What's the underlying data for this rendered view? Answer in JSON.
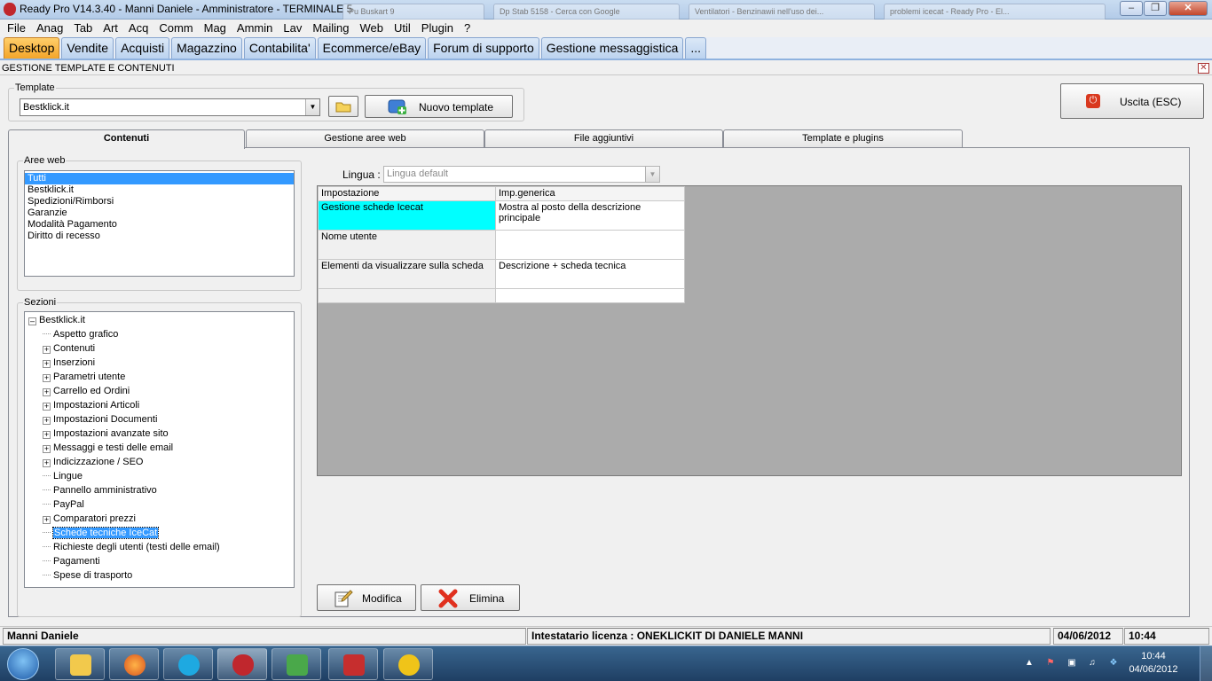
{
  "window": {
    "title": "Ready Pro V14.3.40 - Manni Daniele - Amministratore - TERMINALE 5",
    "background_tabs": [
      "Pu Buskart 9",
      "Dp Stab 5158 - Cerca con Google",
      "Ventilatori - Benzinawii nell'uso dei...",
      "problemi icecat - Ready Pro - El..."
    ]
  },
  "menu": [
    "File",
    "Anag",
    "Tab",
    "Art",
    "Acq",
    "Comm",
    "Mag",
    "Ammin",
    "Lav",
    "Mailing",
    "Web",
    "Util",
    "Plugin",
    "?"
  ],
  "modules": [
    "Desktop",
    "Vendite",
    "Acquisti",
    "Magazzino",
    "Contabilita'",
    "Ecommerce/eBay",
    "Forum di supporto",
    "Gestione messaggistica",
    "..."
  ],
  "form": {
    "title": "GESTIONE TEMPLATE E CONTENUTI",
    "template_legend": "Template",
    "template_value": "Bestklick.it",
    "new_template_label": "Nuovo template",
    "exit_label": "Uscita (ESC)"
  },
  "tabs": [
    "Contenuti",
    "Gestione aree web",
    "File aggiuntivi",
    "Template e plugins"
  ],
  "aree_web": {
    "legend": "Aree web",
    "items": [
      "Tutti",
      "Bestklick.it",
      "Spedizioni/Rimborsi",
      "Garanzie",
      "Modalità Pagamento",
      "Diritto di recesso"
    ]
  },
  "sezioni": {
    "legend": "Sezioni",
    "root": "Bestklick.it",
    "items": [
      {
        "label": "Aspetto grafico",
        "expandable": false
      },
      {
        "label": "Contenuti",
        "expandable": true
      },
      {
        "label": "Inserzioni",
        "expandable": true
      },
      {
        "label": "Parametri utente",
        "expandable": true
      },
      {
        "label": "Carrello ed Ordini",
        "expandable": true
      },
      {
        "label": "Impostazioni Articoli",
        "expandable": true
      },
      {
        "label": "Impostazioni Documenti",
        "expandable": true
      },
      {
        "label": "Impostazioni avanzate sito",
        "expandable": true
      },
      {
        "label": "Messaggi e testi delle email",
        "expandable": true
      },
      {
        "label": "Indicizzazione / SEO",
        "expandable": true
      },
      {
        "label": "Lingue",
        "expandable": false
      },
      {
        "label": "Pannello amministrativo",
        "expandable": false
      },
      {
        "label": "PayPal",
        "expandable": false
      },
      {
        "label": "Comparatori prezzi",
        "expandable": true
      },
      {
        "label": "Schede tecniche IceCat",
        "expandable": false,
        "selected": true
      },
      {
        "label": "Richieste degli utenti (testi delle email)",
        "expandable": false
      },
      {
        "label": "Pagamenti",
        "expandable": false
      },
      {
        "label": "Spese di trasporto",
        "expandable": false
      }
    ]
  },
  "lingua": {
    "label": "Lingua :",
    "value": "Lingua default"
  },
  "grid": {
    "columns": [
      "Impostazione",
      "Imp.generica"
    ],
    "rows": [
      {
        "setting": "Gestione schede Icecat",
        "value": "Mostra al posto della descrizione principale"
      },
      {
        "setting": "Nome utente",
        "value": ""
      },
      {
        "setting": "Elementi da visualizzare sulla scheda",
        "value": "Descrizione + scheda tecnica"
      }
    ]
  },
  "actions": {
    "edit_label": "Modifica",
    "delete_label": "Elimina"
  },
  "status": {
    "user": "Manni Daniele",
    "license": "Intestatario licenza : ONEKLICKIT DI DANIELE MANNI",
    "date": "04/06/2012",
    "time": "10:44"
  },
  "taskbar": {
    "clock_time": "10:44",
    "clock_date": "04/06/2012",
    "apps": [
      "start-orb",
      "explorer-icon",
      "firefox-icon",
      "skype-icon",
      "readypro-icon",
      "network-app-icon",
      "filezilla-icon",
      "outlook-icon"
    ]
  },
  "colors": {
    "accent": "#3399ff",
    "highlight_cell": "#00ffff",
    "active_module": "#f3a52a"
  }
}
